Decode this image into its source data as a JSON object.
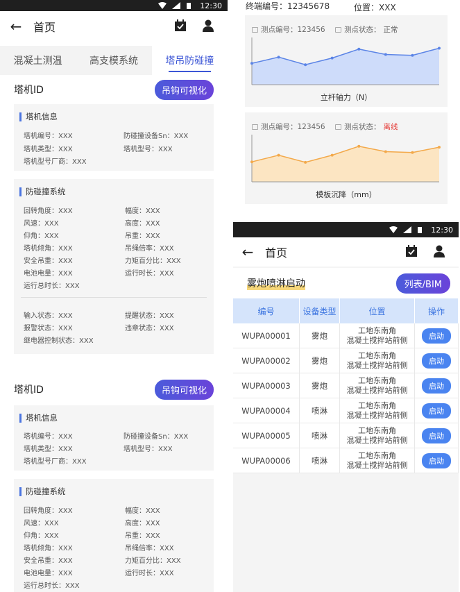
{
  "status": {
    "time": "12:30"
  },
  "nav": {
    "title": "首页"
  },
  "tabs": [
    "混凝土测温",
    "高支模系统",
    "塔吊防碰撞"
  ],
  "crane": {
    "id_label": "塔机ID",
    "visual_button": "吊钩可视化",
    "info_title": "塔机信息",
    "info": {
      "code": "塔机编号：XXX",
      "sn": "防碰撞设备Sn：XXX",
      "type": "塔机类型：XXX",
      "model": "塔机型号：XXX",
      "maker": "塔机型号厂商：XXX"
    },
    "anti_title": "防碰撞系统",
    "anti": {
      "rotation": "回转角度：XXX",
      "amplitude": "幅度：XXX",
      "wind": "风速：XXX",
      "height": "高度：XXX",
      "elevation": "仰角：XXX",
      "weight": "吊重：XXX",
      "tilt": "塔机倾角：XXX",
      "rope": "吊绳倍率：XXX",
      "safe": "安全吊重：XXX",
      "torque": "力矩百分比：XXX",
      "battery": "电池电量：XXX",
      "runtime": "运行时长：XXX",
      "total": "运行总时长：XXX"
    },
    "status": {
      "input": "输入状态：XXX",
      "remind": "提醒状态：XXX",
      "alarm": "报警状态：XXX",
      "violation": "违章状态：XXX",
      "relay": "继电器控制状态：XXX"
    }
  },
  "terminal": {
    "code": "终端编号：12345678",
    "position": "位置：XXX"
  },
  "chart_data": [
    {
      "type": "area",
      "point_code": "测点编号：123456",
      "point_status_label": "测点状态：",
      "point_status": "正常",
      "xlabel": "立杆轴力（N）",
      "values": [
        48,
        62,
        45,
        60,
        80,
        68,
        66,
        82
      ],
      "color": "#5b84e6",
      "fill": "#c7d7fa"
    },
    {
      "type": "area",
      "point_code": "测点编号：123456",
      "point_status_label": "测点状态：",
      "point_status": "离线",
      "xlabel": "模板沉降（mm）",
      "values": [
        45,
        60,
        44,
        60,
        80,
        68,
        66,
        78
      ],
      "color": "#f3a94a",
      "fill": "#fde2b9"
    }
  ],
  "spray": {
    "title": "雾炮喷淋启动",
    "toggle": "列表/BIM",
    "headers": [
      "编号",
      "设备类型",
      "位置",
      "操作"
    ],
    "rows": [
      {
        "id": "WUPA00001",
        "type": "雾炮",
        "loc1": "工地东南角",
        "loc2": "混凝土搅拌站前侧",
        "action": "启动"
      },
      {
        "id": "WUPA00002",
        "type": "雾炮",
        "loc1": "工地东南角",
        "loc2": "混凝土搅拌站前侧",
        "action": "启动"
      },
      {
        "id": "WUPA00003",
        "type": "雾炮",
        "loc1": "工地东南角",
        "loc2": "混凝土搅拌站前侧",
        "action": "启动"
      },
      {
        "id": "WUPA00004",
        "type": "喷淋",
        "loc1": "工地东南角",
        "loc2": "混凝土搅拌站前侧",
        "action": "启动"
      },
      {
        "id": "WUPA00005",
        "type": "喷淋",
        "loc1": "工地东南角",
        "loc2": "混凝土搅拌站前侧",
        "action": "启动"
      },
      {
        "id": "WUPA00006",
        "type": "喷淋",
        "loc1": "工地东南角",
        "loc2": "混凝土搅拌站前侧",
        "action": "启动"
      }
    ]
  },
  "colors": {
    "accent": "#3c56d6",
    "offline": "#e53935",
    "table_header": "#d5e4fb"
  }
}
